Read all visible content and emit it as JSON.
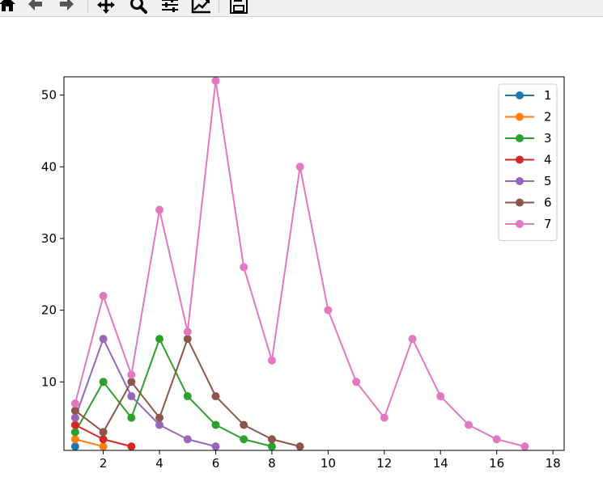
{
  "toolbar": {
    "tools": [
      {
        "name": "home-icon"
      },
      {
        "name": "back-arrow-icon"
      },
      {
        "name": "forward-arrow-icon"
      },
      {
        "name": "pan-move-icon"
      },
      {
        "name": "zoom-magnifier-icon"
      },
      {
        "name": "configure-subplots-icon"
      },
      {
        "name": "edit-axis-icon"
      },
      {
        "name": "save-floppy-icon"
      }
    ]
  },
  "chart_data": {
    "type": "line",
    "title": "",
    "xlabel": "",
    "ylabel": "",
    "xlim": [
      0.6,
      18.4
    ],
    "ylim": [
      0.45,
      52.55
    ],
    "xticks": [
      2,
      4,
      6,
      8,
      10,
      12,
      14,
      16,
      18
    ],
    "yticks": [
      10,
      20,
      30,
      40,
      50
    ],
    "grid": false,
    "legend_position": "upper right",
    "marker": "circle",
    "series": [
      {
        "name": "1",
        "color": "#1f77b4",
        "x": [
          1
        ],
        "y": [
          1
        ]
      },
      {
        "name": "2",
        "color": "#ff7f0e",
        "x": [
          1,
          2
        ],
        "y": [
          2,
          1
        ]
      },
      {
        "name": "3",
        "color": "#2ca02c",
        "x": [
          1,
          2,
          3,
          4,
          5,
          6,
          7,
          8
        ],
        "y": [
          3,
          10,
          5,
          16,
          8,
          4,
          2,
          1
        ]
      },
      {
        "name": "4",
        "color": "#d62728",
        "x": [
          1,
          2,
          3
        ],
        "y": [
          4,
          2,
          1
        ]
      },
      {
        "name": "5",
        "color": "#9467bd",
        "x": [
          1,
          2,
          3,
          4,
          5,
          6
        ],
        "y": [
          5,
          16,
          8,
          4,
          2,
          1
        ]
      },
      {
        "name": "6",
        "color": "#8c564b",
        "x": [
          1,
          2,
          3,
          4,
          5,
          6,
          7,
          8,
          9
        ],
        "y": [
          6,
          3,
          10,
          5,
          16,
          8,
          4,
          2,
          1
        ]
      },
      {
        "name": "7",
        "color": "#e377c2",
        "x": [
          1,
          2,
          3,
          4,
          5,
          6,
          7,
          8,
          9,
          10,
          11,
          12,
          13,
          14,
          15,
          16,
          17
        ],
        "y": [
          7,
          22,
          11,
          34,
          17,
          52,
          26,
          13,
          40,
          20,
          10,
          5,
          16,
          8,
          4,
          2,
          1
        ]
      }
    ]
  }
}
